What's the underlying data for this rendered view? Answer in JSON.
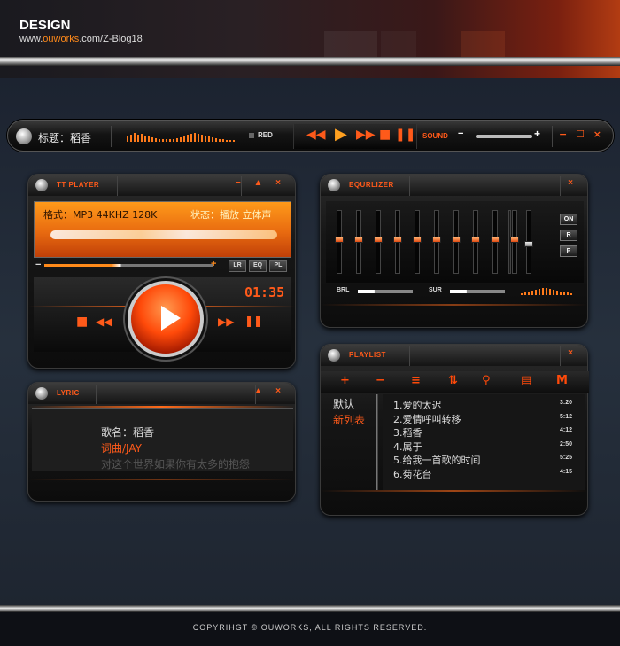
{
  "header": {
    "brand": "DESIGN",
    "url_prefix": "www.",
    "url_domain": "ouworks",
    "url_suffix": ".com/Z-Blog18"
  },
  "mini": {
    "title": "标题：稻香",
    "red_label": "RED",
    "sound_label": "SOUND",
    "minus": "−",
    "plus": "+",
    "win_buttons": "− ☐ ×"
  },
  "tt": {
    "title": "TT PLAYER",
    "win_buttons": "− ▲ ×",
    "format": "格式：MP3 44KHZ 128K",
    "status": "状态：播放 立体声",
    "minus": "−",
    "plus": "+",
    "buttons": [
      "LR",
      "EQ",
      "PL"
    ],
    "time": "01:35"
  },
  "eq": {
    "title": "EQURLIZER",
    "close": "×",
    "bands": [
      0.45,
      0.45,
      0.45,
      0.45,
      0.45,
      0.45,
      0.45,
      0.45,
      0.45,
      0.45
    ],
    "side_buttons": [
      "ON",
      "R",
      "P"
    ],
    "brl": "BRL",
    "sur": "SUR"
  },
  "lyric": {
    "title": "LYRIC",
    "win_buttons": "▲ ×",
    "lines": [
      "歌名：稻香",
      "词曲/JAY",
      "对这个世界如果你有太多的抱怨"
    ]
  },
  "playlist": {
    "title": "PLAYLIST",
    "close": "×",
    "toolbar": [
      "+",
      "−",
      "≡",
      "⇅",
      "⚲",
      "▤",
      "M"
    ],
    "lists": [
      "默认",
      "新列表"
    ],
    "tracks": [
      {
        "name": "1.爱的太迟",
        "dur": "3:20"
      },
      {
        "name": "2.爱情呼叫转移",
        "dur": "5:12"
      },
      {
        "name": "3.稻香",
        "dur": "4:12"
      },
      {
        "name": "4.属于",
        "dur": "2:50"
      },
      {
        "name": "5.给我一首歌的时间",
        "dur": "5:25"
      },
      {
        "name": "6.菊花台",
        "dur": "4:15"
      }
    ]
  },
  "footer": {
    "copyright": "COPYRIHGT © OUWORKS, ALL RIGHTS RESERVED."
  }
}
